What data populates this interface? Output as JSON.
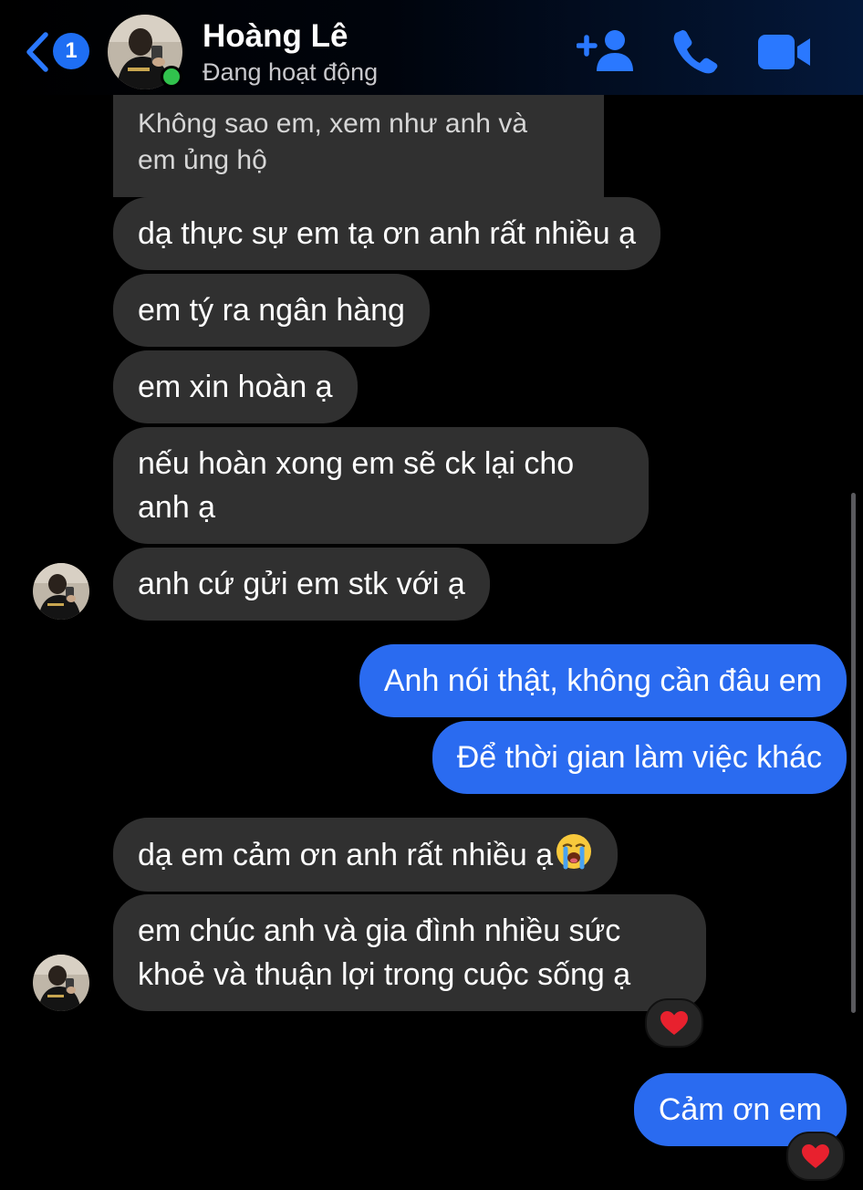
{
  "header": {
    "back_badge": "1",
    "contact_name": "Hoàng Lê",
    "contact_status": "Đang hoạt động",
    "icons": [
      "chevron-left-icon",
      "add-person-icon",
      "phone-icon",
      "video-camera-icon"
    ],
    "accent_color": "#1e6ef3",
    "online_color": "#31c24d"
  },
  "messages": [
    {
      "from": "contact",
      "text_lines": [
        "Không sao em, xem như anh và",
        "em ủng hộ"
      ]
    },
    {
      "from": "contact",
      "text": "dạ thực sự em tạ ơn anh rất nhiều ạ"
    },
    {
      "from": "contact",
      "text": "em tý ra ngân hàng"
    },
    {
      "from": "contact",
      "text": "em xin hoàn ạ"
    },
    {
      "from": "contact",
      "text_lines": [
        "nếu hoàn xong em sẽ ck lại cho",
        "anh ạ"
      ]
    },
    {
      "from": "contact",
      "text": "anh cứ gửi em stk với ạ"
    },
    {
      "from": "me",
      "text": "Anh nói thật, không cần đâu em"
    },
    {
      "from": "me",
      "text": "Để thời gian làm việc khác"
    },
    {
      "from": "contact",
      "text": "dạ em cảm ơn anh rất nhiều ạ",
      "emoji": "loudly-crying-face"
    },
    {
      "from": "contact",
      "text_lines": [
        "em chúc anh và gia đình nhiều sức",
        "khoẻ và thuận lợi trong cuộc sống ạ"
      ],
      "reaction": "red-heart"
    },
    {
      "from": "me",
      "text": "Cảm ơn em",
      "reaction": "red-heart"
    }
  ],
  "colors": {
    "incoming_bubble": "#303030",
    "outgoing_bubble": "#2a6bf0",
    "background": "#000000"
  }
}
